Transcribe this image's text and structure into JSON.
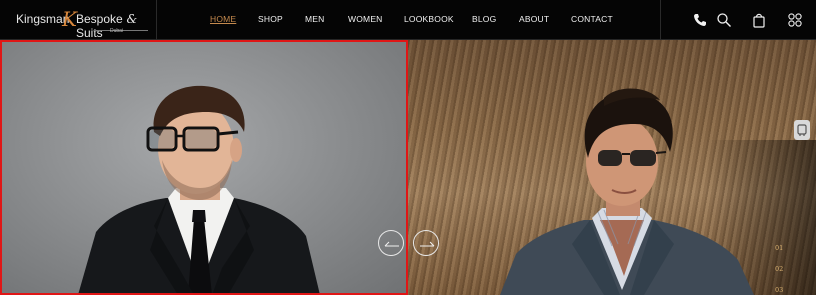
{
  "brand": {
    "left": "Kingsman",
    "amp": "K",
    "right": "Bespoke",
    "suffix": "Suits",
    "sub": "Dubai"
  },
  "nav": [
    "HOME",
    "SHOP",
    "MEN",
    "WOMEN",
    "LOOKBOOK",
    "BLOG",
    "ABOUT",
    "CONTACT"
  ],
  "nav_active": "HOME",
  "header_icons": [
    "phone-icon",
    "search-icon",
    "shopping-bag-icon",
    "menu-grid-icon"
  ],
  "slider": {
    "prev_label": "previous slide",
    "next_label": "next slide",
    "pages": [
      "01",
      "02",
      "03"
    ]
  },
  "colors": {
    "accent": "#c58a4e",
    "active_border": "#e01616",
    "header_bg": "#050505"
  }
}
